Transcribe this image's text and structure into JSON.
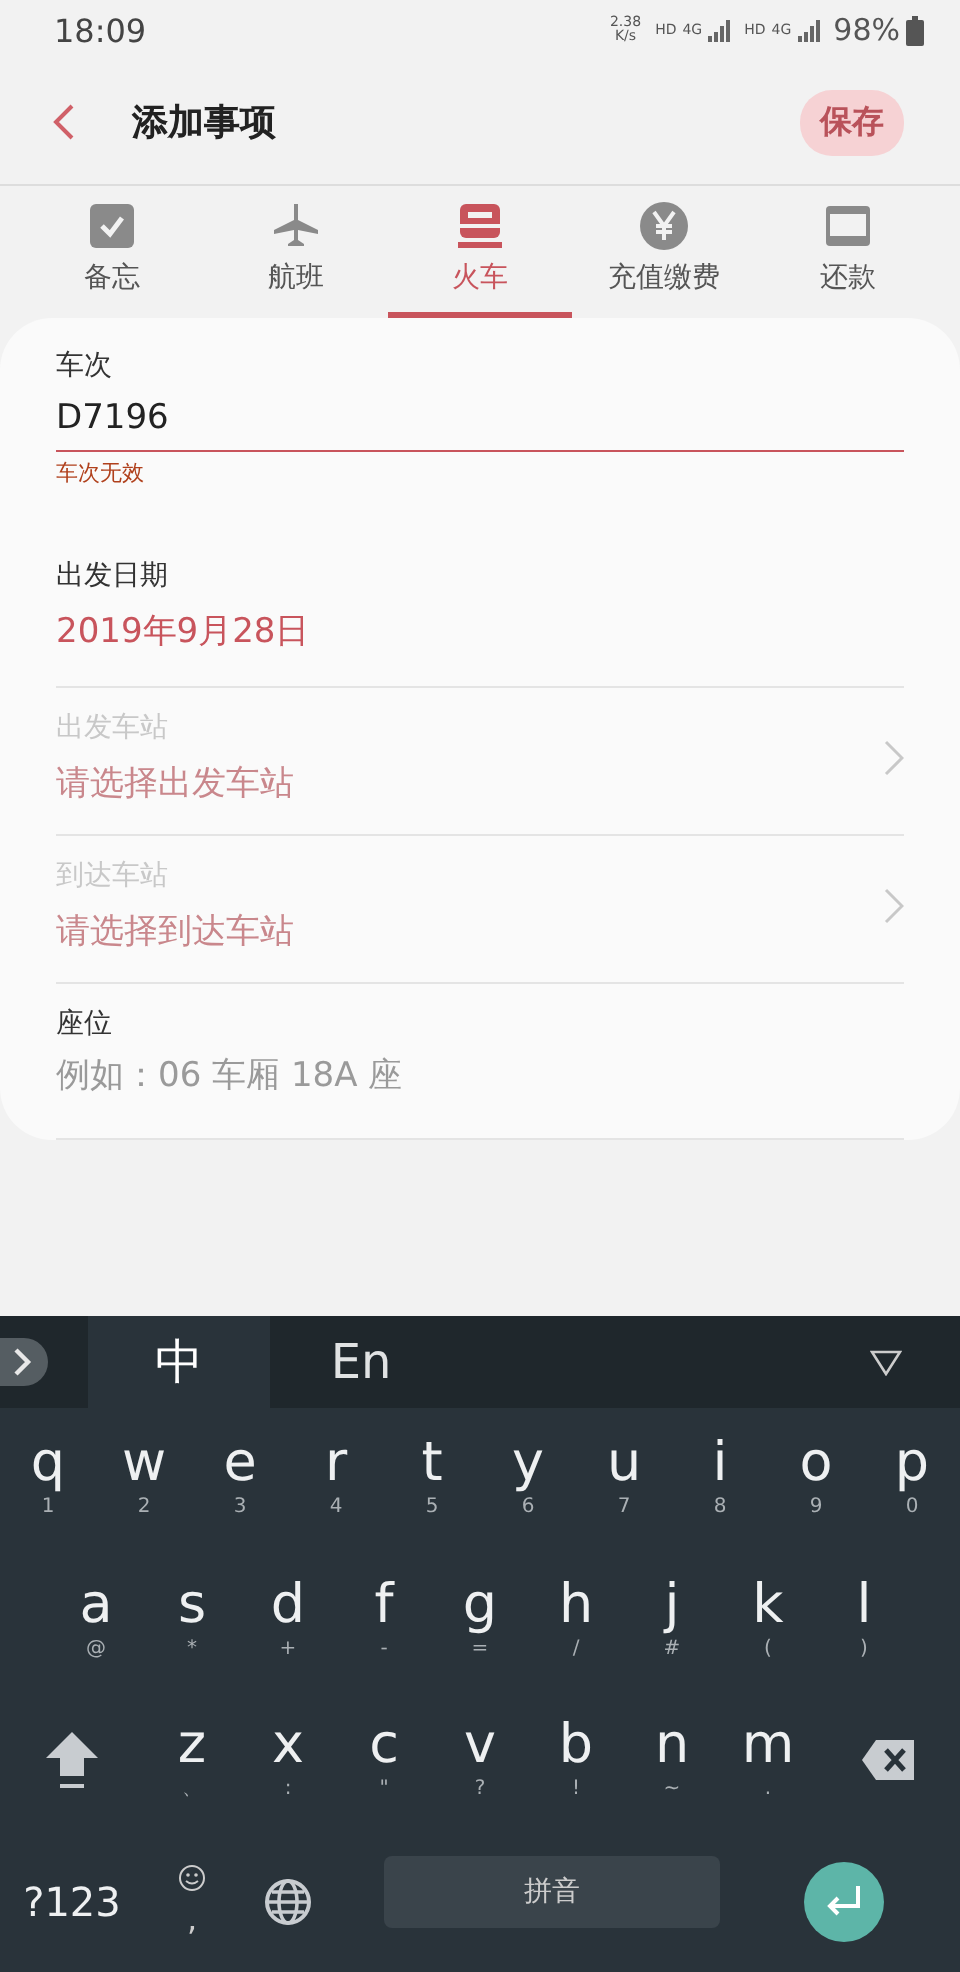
{
  "status_bar": {
    "time": "18:09",
    "speed_value": "2.38",
    "speed_unit": "K/s",
    "signals": [
      {
        "hd": "HD",
        "net": "4G"
      },
      {
        "hd": "HD",
        "net": "4G"
      }
    ],
    "battery": "98%"
  },
  "header": {
    "title": "添加事项",
    "save_button": {
      "label": "保存",
      "disabled": true
    }
  },
  "tabs": [
    {
      "label": "备忘",
      "selected": false
    },
    {
      "label": "航班",
      "selected": false
    },
    {
      "label": "火车",
      "selected": true
    },
    {
      "label": "充值缴费",
      "selected": false
    },
    {
      "label": "还款",
      "selected": false
    }
  ],
  "fields": [
    {
      "kind": "input",
      "label": "车次",
      "value": "D7196",
      "error": "车次无效"
    },
    {
      "kind": "value",
      "label": "出发日期",
      "value": "2019年9月28日"
    },
    {
      "kind": "select",
      "label": "出发车站",
      "placeholder": "请选择出发车站",
      "disabled": true
    },
    {
      "kind": "select",
      "label": "到达车站",
      "placeholder": "请选择到达车站",
      "disabled": true
    },
    {
      "kind": "input",
      "label": "座位",
      "placeholder": "例如：06 车厢 18A 座"
    }
  ],
  "keyboard": {
    "modes": [
      {
        "label": "中",
        "selected": true
      },
      {
        "label": "En",
        "selected": false
      }
    ],
    "rows": [
      [
        {
          "kind": "letter",
          "main": "q",
          "sub": "1"
        },
        {
          "kind": "letter",
          "main": "w",
          "sub": "2"
        },
        {
          "kind": "letter",
          "main": "e",
          "sub": "3"
        },
        {
          "kind": "letter",
          "main": "r",
          "sub": "4"
        },
        {
          "kind": "letter",
          "main": "t",
          "sub": "5"
        },
        {
          "kind": "letter",
          "main": "y",
          "sub": "6"
        },
        {
          "kind": "letter",
          "main": "u",
          "sub": "7"
        },
        {
          "kind": "letter",
          "main": "i",
          "sub": "8"
        },
        {
          "kind": "letter",
          "main": "o",
          "sub": "9"
        },
        {
          "kind": "letter",
          "main": "p",
          "sub": "0"
        }
      ],
      [
        {
          "kind": "letter",
          "main": "a",
          "sub": "@"
        },
        {
          "kind": "letter",
          "main": "s",
          "sub": "*"
        },
        {
          "kind": "letter",
          "main": "d",
          "sub": "+"
        },
        {
          "kind": "letter",
          "main": "f",
          "sub": "-"
        },
        {
          "kind": "letter",
          "main": "g",
          "sub": "="
        },
        {
          "kind": "letter",
          "main": "h",
          "sub": "/"
        },
        {
          "kind": "letter",
          "main": "j",
          "sub": "#"
        },
        {
          "kind": "letter",
          "main": "k",
          "sub": "("
        },
        {
          "kind": "letter",
          "main": "l",
          "sub": ")"
        }
      ],
      [
        {
          "kind": "shift"
        },
        {
          "kind": "letter",
          "main": "z",
          "sub": "、"
        },
        {
          "kind": "letter",
          "main": "x",
          "sub": ":"
        },
        {
          "kind": "letter",
          "main": "c",
          "sub": "\""
        },
        {
          "kind": "letter",
          "main": "v",
          "sub": "?"
        },
        {
          "kind": "letter",
          "main": "b",
          "sub": "!"
        },
        {
          "kind": "letter",
          "main": "n",
          "sub": "~"
        },
        {
          "kind": "letter",
          "main": "m",
          "sub": "."
        },
        {
          "kind": "backspace"
        }
      ],
      [
        {
          "kind": "symbols",
          "main": "?123"
        },
        {
          "kind": "emoji",
          "sub": ","
        },
        {
          "kind": "globe"
        },
        {
          "kind": "space",
          "main": "拼音"
        },
        {
          "kind": "enter"
        }
      ]
    ]
  }
}
